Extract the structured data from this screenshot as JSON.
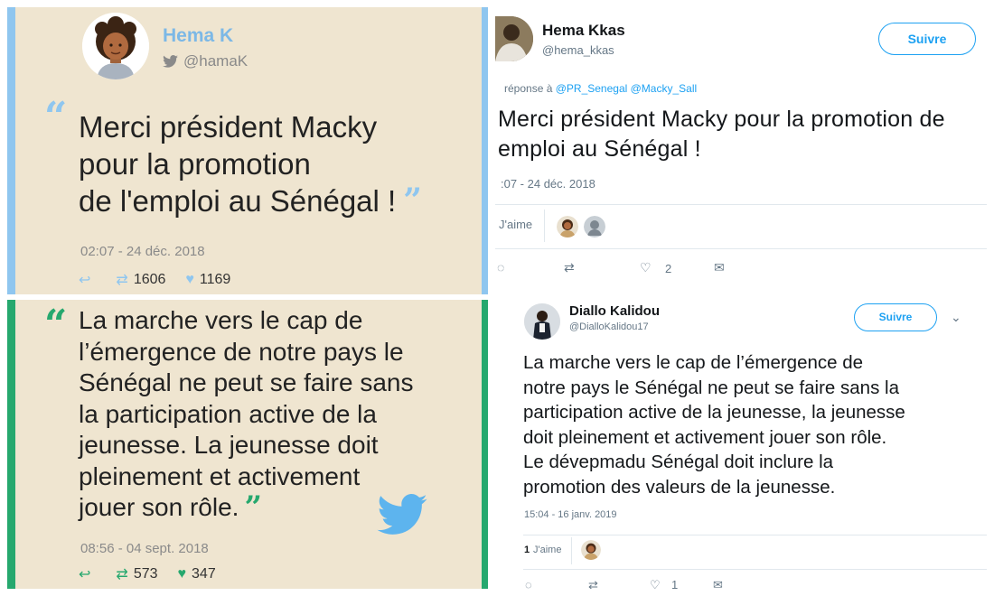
{
  "card_top": {
    "name": "Hema K",
    "handle": "@hamaK",
    "quote": "Merci président Macky pour la promotion de l'emploi au Sénégal !",
    "quote_lines": [
      "Merci président Macky",
      "pour la promotion",
      "de l'emploi au Sénégal !"
    ],
    "time": "02:07 - 24 déc. 2018",
    "retweets": "1606",
    "likes": "1169"
  },
  "card_bottom": {
    "quote_lines": [
      "La marche vers le cap de",
      "l’émergence de notre pays le",
      "Sénégal ne peut se faire sans",
      "la participation active de la",
      "jeunesse. La jeunesse doit",
      "pleinement et activement",
      "jouer son rôle."
    ],
    "time": "08:56 - 04 sept. 2018",
    "retweets": "573",
    "likes": "347"
  },
  "tweet_top": {
    "name": "Hema Kkas",
    "handle": "@hema_kkas",
    "follow_label": "Suivre",
    "reply_prefix": "réponse à",
    "reply_mentions": "@PR_Senegal @Macky_Sall",
    "body_lines": [
      "Merci président Macky pour la promotion de",
      "emploi au Sénégal !"
    ],
    "time": ":07 - 24 déc. 2018",
    "likes_label": "J'aime",
    "heart_count": "2"
  },
  "tweet_bottom": {
    "name": "Diallo Kalidou",
    "handle": "@DialloKalidou17",
    "follow_label": "Suivre",
    "body_lines": [
      "La marche vers le cap de l’émergence de",
      "notre pays le Sénégal ne peut se faire sans la",
      "participation active de la jeunesse, la jeunesse",
      "doit pleinement et activement jouer son rôle.",
      "Le dévepmadu Sénégal doit inclure la",
      "promotion des valeurs de la jeunesse."
    ],
    "time": "15:04 - 16 janv. 2019",
    "likes_count": "1",
    "likes_label": "J'aime",
    "heart_count": "1"
  },
  "icons": {
    "reply": "reply-arrow-icon",
    "retweet": "retweet-icon",
    "like": "heart-icon",
    "dm": "envelope-icon",
    "twitter": "twitter-bird-icon"
  },
  "colors": {
    "card_bg": "#efe5d0",
    "card_top_accent": "#8fc6ef",
    "card_bottom_accent": "#26a86e",
    "twitter_blue": "#1da1f2",
    "text_muted": "#657786"
  }
}
